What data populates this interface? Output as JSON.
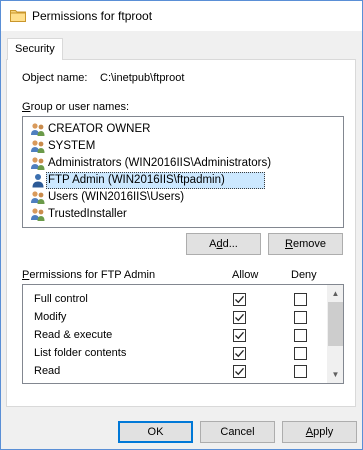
{
  "window": {
    "title": "Permissions for ftproot"
  },
  "tabs": [
    {
      "label": "Security"
    }
  ],
  "object": {
    "label": "Object name:",
    "value": "C:\\inetpub\\ftproot"
  },
  "groups": {
    "label_prefix": "",
    "label_underlined": "G",
    "label_rest": "roup or user names:",
    "items": [
      {
        "label": "CREATOR OWNER",
        "icon": "users-group-icon",
        "selected": false
      },
      {
        "label": "SYSTEM",
        "icon": "users-group-icon",
        "selected": false
      },
      {
        "label": "Administrators (WIN2016IIS\\Administrators)",
        "icon": "users-group-icon",
        "selected": false
      },
      {
        "label": "FTP Admin (WIN2016IIS\\ftpadmin)",
        "icon": "user-icon",
        "selected": true
      },
      {
        "label": "Users (WIN2016IIS\\Users)",
        "icon": "users-group-icon",
        "selected": false
      },
      {
        "label": "TrustedInstaller",
        "icon": "users-group-icon",
        "selected": false
      }
    ]
  },
  "buttons": {
    "add": {
      "pre": "A",
      "u": "d",
      "post": "d..."
    },
    "remove": {
      "pre": "",
      "u": "R",
      "post": "emove"
    },
    "ok": "OK",
    "cancel": "Cancel",
    "apply": {
      "pre": "",
      "u": "A",
      "post": "pply"
    }
  },
  "permissions": {
    "label_prefix": "",
    "label_underlined": "P",
    "label_rest": "ermissions for FTP Admin",
    "allow_label": "Allow",
    "deny_label": "Deny",
    "rows": [
      {
        "name": "Full control",
        "allow": true,
        "deny": false
      },
      {
        "name": "Modify",
        "allow": true,
        "deny": false
      },
      {
        "name": "Read & execute",
        "allow": true,
        "deny": false
      },
      {
        "name": "List folder contents",
        "allow": true,
        "deny": false
      },
      {
        "name": "Read",
        "allow": true,
        "deny": false
      },
      {
        "name": "",
        "allow": true,
        "deny": false
      }
    ]
  },
  "colors": {
    "accent": "#0078d7",
    "selection": "#cce8ff",
    "folder": "#e8b84a"
  }
}
